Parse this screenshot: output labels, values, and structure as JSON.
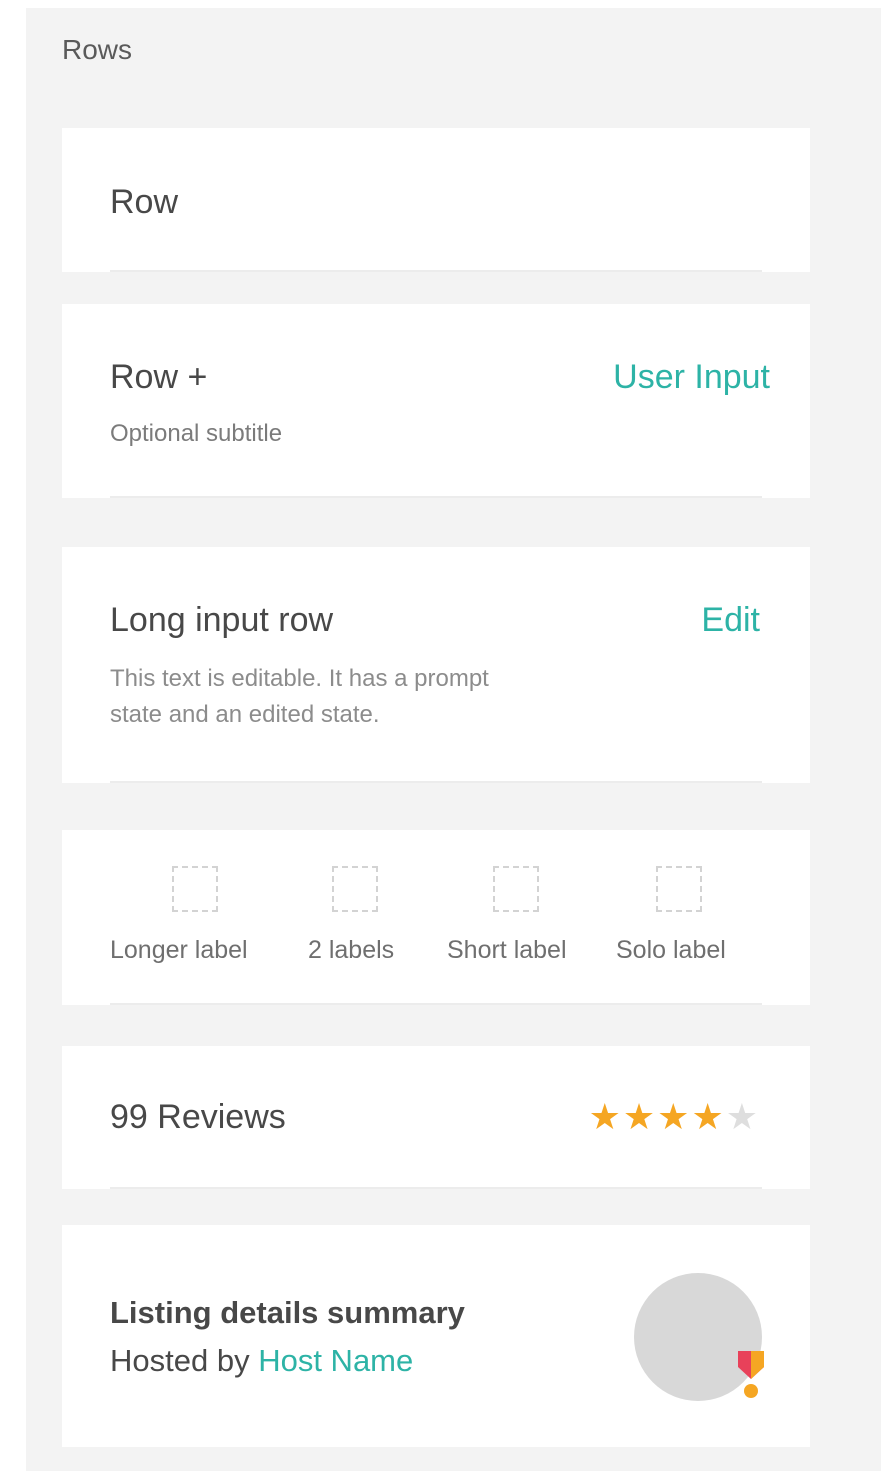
{
  "section": {
    "title": "Rows"
  },
  "row_simple": {
    "title": "Row"
  },
  "row_plus": {
    "title": "Row +",
    "subtitle": "Optional subtitle",
    "action": "User Input"
  },
  "long_input": {
    "title": "Long input row",
    "action": "Edit",
    "description_line1": "This text is editable. It has a prompt",
    "description_line2": "state and an edited state."
  },
  "checkbox_row": {
    "items": [
      {
        "label": "Longer label"
      },
      {
        "label": "2 labels"
      },
      {
        "label": "Short label"
      },
      {
        "label": "Solo label"
      }
    ]
  },
  "reviews": {
    "label": "99 Reviews",
    "rating": 4,
    "max_rating": 5,
    "star_color": "#f5a623"
  },
  "listing": {
    "title": "Listing details summary",
    "hosted_prefix": "Hosted by ",
    "host_name": "Host Name",
    "avatar_icon": "host-avatar",
    "badge_icon": "superhost-badge-icon"
  },
  "colors": {
    "accent": "#2db3a6",
    "background": "#f3f3f3",
    "card": "#ffffff"
  }
}
